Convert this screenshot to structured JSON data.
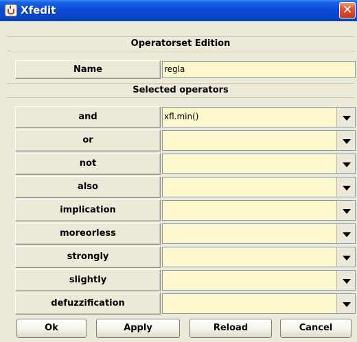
{
  "window": {
    "title": "Xfedit",
    "close_glyph": "✕"
  },
  "header1": "Operatorset Edition",
  "name_row": {
    "label": "Name",
    "value": "regla"
  },
  "header2": "Selected operators",
  "operators": [
    {
      "label": "and",
      "value": "xfl.min()"
    },
    {
      "label": "or",
      "value": ""
    },
    {
      "label": "not",
      "value": ""
    },
    {
      "label": "also",
      "value": ""
    },
    {
      "label": "implication",
      "value": ""
    },
    {
      "label": "moreorless",
      "value": ""
    },
    {
      "label": "strongly",
      "value": ""
    },
    {
      "label": "slightly",
      "value": ""
    },
    {
      "label": "defuzzification",
      "value": ""
    }
  ],
  "buttons": {
    "ok": "Ok",
    "apply": "Apply",
    "reload": "Reload",
    "cancel": "Cancel"
  }
}
